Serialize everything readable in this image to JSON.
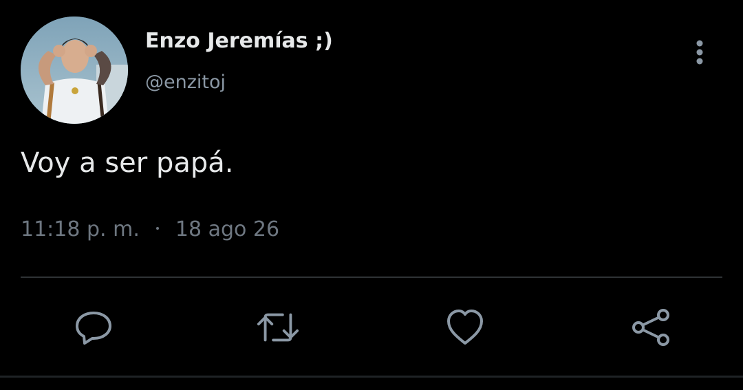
{
  "tweet": {
    "author": {
      "display_name": "Enzo Jeremías ;)",
      "handle": "@enzitoj"
    },
    "text": "Voy a ser papá.",
    "time": "11:18 p. m.",
    "date": "18 ago 26"
  },
  "actions": {
    "reply_icon": "reply-icon",
    "retweet_icon": "retweet-icon",
    "like_icon": "like-icon",
    "share_icon": "share-icon"
  },
  "colors": {
    "background": "#000000",
    "primary_text": "#e7e9ea",
    "secondary_text": "#8b98a5",
    "icon": "#8b98a5",
    "divider": "#2f3336"
  }
}
